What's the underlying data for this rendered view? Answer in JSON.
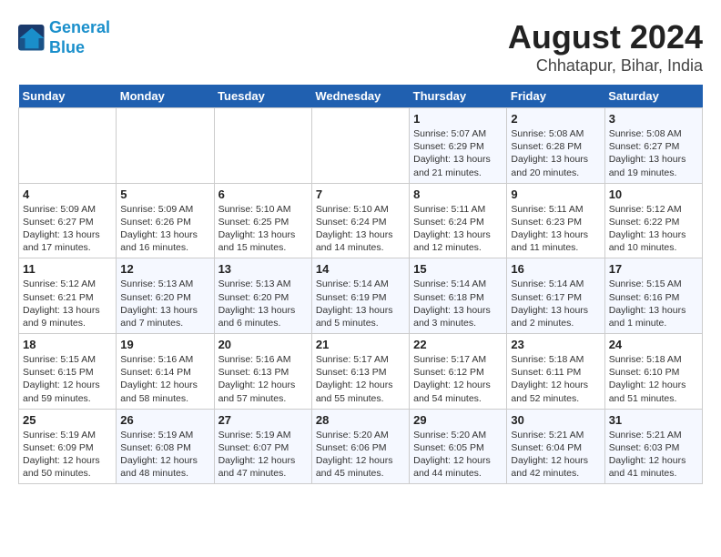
{
  "logo": {
    "line1": "General",
    "line2": "Blue"
  },
  "title": "August 2024",
  "subtitle": "Chhatapur, Bihar, India",
  "days_of_week": [
    "Sunday",
    "Monday",
    "Tuesday",
    "Wednesday",
    "Thursday",
    "Friday",
    "Saturday"
  ],
  "weeks": [
    [
      {
        "day": "",
        "info": ""
      },
      {
        "day": "",
        "info": ""
      },
      {
        "day": "",
        "info": ""
      },
      {
        "day": "",
        "info": ""
      },
      {
        "day": "1",
        "info": "Sunrise: 5:07 AM\nSunset: 6:29 PM\nDaylight: 13 hours\nand 21 minutes."
      },
      {
        "day": "2",
        "info": "Sunrise: 5:08 AM\nSunset: 6:28 PM\nDaylight: 13 hours\nand 20 minutes."
      },
      {
        "day": "3",
        "info": "Sunrise: 5:08 AM\nSunset: 6:27 PM\nDaylight: 13 hours\nand 19 minutes."
      }
    ],
    [
      {
        "day": "4",
        "info": "Sunrise: 5:09 AM\nSunset: 6:27 PM\nDaylight: 13 hours\nand 17 minutes."
      },
      {
        "day": "5",
        "info": "Sunrise: 5:09 AM\nSunset: 6:26 PM\nDaylight: 13 hours\nand 16 minutes."
      },
      {
        "day": "6",
        "info": "Sunrise: 5:10 AM\nSunset: 6:25 PM\nDaylight: 13 hours\nand 15 minutes."
      },
      {
        "day": "7",
        "info": "Sunrise: 5:10 AM\nSunset: 6:24 PM\nDaylight: 13 hours\nand 14 minutes."
      },
      {
        "day": "8",
        "info": "Sunrise: 5:11 AM\nSunset: 6:24 PM\nDaylight: 13 hours\nand 12 minutes."
      },
      {
        "day": "9",
        "info": "Sunrise: 5:11 AM\nSunset: 6:23 PM\nDaylight: 13 hours\nand 11 minutes."
      },
      {
        "day": "10",
        "info": "Sunrise: 5:12 AM\nSunset: 6:22 PM\nDaylight: 13 hours\nand 10 minutes."
      }
    ],
    [
      {
        "day": "11",
        "info": "Sunrise: 5:12 AM\nSunset: 6:21 PM\nDaylight: 13 hours\nand 9 minutes."
      },
      {
        "day": "12",
        "info": "Sunrise: 5:13 AM\nSunset: 6:20 PM\nDaylight: 13 hours\nand 7 minutes."
      },
      {
        "day": "13",
        "info": "Sunrise: 5:13 AM\nSunset: 6:20 PM\nDaylight: 13 hours\nand 6 minutes."
      },
      {
        "day": "14",
        "info": "Sunrise: 5:14 AM\nSunset: 6:19 PM\nDaylight: 13 hours\nand 5 minutes."
      },
      {
        "day": "15",
        "info": "Sunrise: 5:14 AM\nSunset: 6:18 PM\nDaylight: 13 hours\nand 3 minutes."
      },
      {
        "day": "16",
        "info": "Sunrise: 5:14 AM\nSunset: 6:17 PM\nDaylight: 13 hours\nand 2 minutes."
      },
      {
        "day": "17",
        "info": "Sunrise: 5:15 AM\nSunset: 6:16 PM\nDaylight: 13 hours\nand 1 minute."
      }
    ],
    [
      {
        "day": "18",
        "info": "Sunrise: 5:15 AM\nSunset: 6:15 PM\nDaylight: 12 hours\nand 59 minutes."
      },
      {
        "day": "19",
        "info": "Sunrise: 5:16 AM\nSunset: 6:14 PM\nDaylight: 12 hours\nand 58 minutes."
      },
      {
        "day": "20",
        "info": "Sunrise: 5:16 AM\nSunset: 6:13 PM\nDaylight: 12 hours\nand 57 minutes."
      },
      {
        "day": "21",
        "info": "Sunrise: 5:17 AM\nSunset: 6:13 PM\nDaylight: 12 hours\nand 55 minutes."
      },
      {
        "day": "22",
        "info": "Sunrise: 5:17 AM\nSunset: 6:12 PM\nDaylight: 12 hours\nand 54 minutes."
      },
      {
        "day": "23",
        "info": "Sunrise: 5:18 AM\nSunset: 6:11 PM\nDaylight: 12 hours\nand 52 minutes."
      },
      {
        "day": "24",
        "info": "Sunrise: 5:18 AM\nSunset: 6:10 PM\nDaylight: 12 hours\nand 51 minutes."
      }
    ],
    [
      {
        "day": "25",
        "info": "Sunrise: 5:19 AM\nSunset: 6:09 PM\nDaylight: 12 hours\nand 50 minutes."
      },
      {
        "day": "26",
        "info": "Sunrise: 5:19 AM\nSunset: 6:08 PM\nDaylight: 12 hours\nand 48 minutes."
      },
      {
        "day": "27",
        "info": "Sunrise: 5:19 AM\nSunset: 6:07 PM\nDaylight: 12 hours\nand 47 minutes."
      },
      {
        "day": "28",
        "info": "Sunrise: 5:20 AM\nSunset: 6:06 PM\nDaylight: 12 hours\nand 45 minutes."
      },
      {
        "day": "29",
        "info": "Sunrise: 5:20 AM\nSunset: 6:05 PM\nDaylight: 12 hours\nand 44 minutes."
      },
      {
        "day": "30",
        "info": "Sunrise: 5:21 AM\nSunset: 6:04 PM\nDaylight: 12 hours\nand 42 minutes."
      },
      {
        "day": "31",
        "info": "Sunrise: 5:21 AM\nSunset: 6:03 PM\nDaylight: 12 hours\nand 41 minutes."
      }
    ]
  ]
}
